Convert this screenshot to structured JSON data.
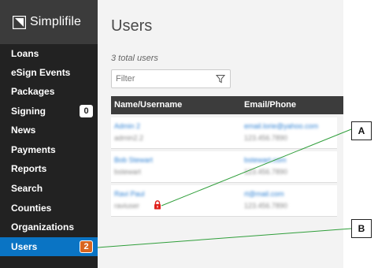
{
  "brand": {
    "name": "Simplifile",
    "icon": "simplifile-logo-icon"
  },
  "sidebar": {
    "items": [
      {
        "label": "Loans",
        "badge": null,
        "active": false
      },
      {
        "label": "eSign Events",
        "badge": null,
        "active": false
      },
      {
        "label": "Packages",
        "badge": null,
        "active": false
      },
      {
        "label": "Signing",
        "badge": "0",
        "active": false
      },
      {
        "label": "News",
        "badge": null,
        "active": false
      },
      {
        "label": "Payments",
        "badge": null,
        "active": false
      },
      {
        "label": "Reports",
        "badge": null,
        "active": false
      },
      {
        "label": "Search",
        "badge": null,
        "active": false
      },
      {
        "label": "Counties",
        "badge": null,
        "active": false
      },
      {
        "label": "Organizations",
        "badge": null,
        "active": false
      },
      {
        "label": "Users",
        "badge": "2",
        "active": true
      }
    ]
  },
  "main": {
    "title": "Users",
    "total_label": "3 total users",
    "filter": {
      "placeholder": "Filter",
      "value": "",
      "icon": "filter-funnel-icon"
    },
    "table": {
      "headers": [
        "Name/Username",
        "Email/Phone"
      ],
      "rows": [
        {
          "name": "Admin 2",
          "username": "admin2.2",
          "email": "email.lorie@yahoo.com",
          "phone": "123.456.7890",
          "locked": false
        },
        {
          "name": "Bob Stewart",
          "username": "bstewart",
          "email": "bstewart.com",
          "phone": "123.456.7890",
          "locked": false
        },
        {
          "name": "Ravi Paul",
          "username": "raviuser",
          "email": "rt@mail.com",
          "phone": "123.456.7890",
          "locked": true
        }
      ]
    }
  },
  "callouts": [
    {
      "label": "A",
      "target": "lock-icon"
    },
    {
      "label": "B",
      "target": "sidebar-item-users"
    }
  ],
  "colors": {
    "sidebar_bg": "#222222",
    "brand_bg": "#3b3b3b",
    "active_item": "#0a74c4",
    "badge_orange": "#d8651f",
    "link": "#2b7fd3",
    "lock": "#e0201b",
    "callout_line": "#2f9e3a"
  }
}
